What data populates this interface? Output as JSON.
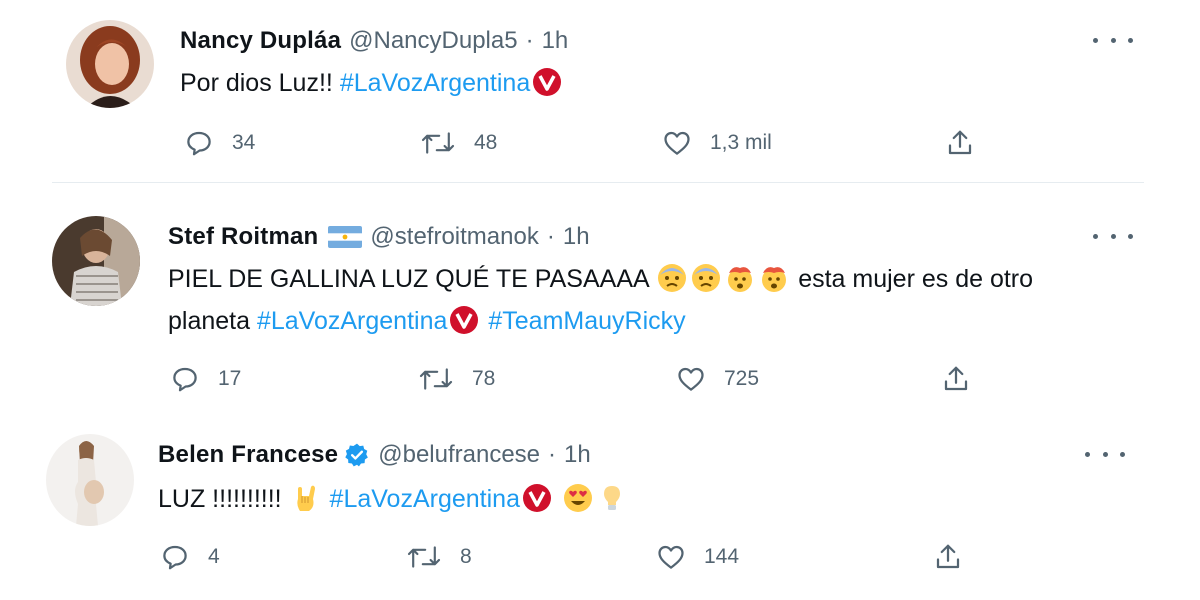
{
  "tweets": [
    {
      "name": "Nancy Dupláa",
      "handle": "@NancyDupla5",
      "separator": "·",
      "time": "1h",
      "text_before": "Por dios Luz!! ",
      "hashtags": [
        "#LaVozArgentina"
      ],
      "replies": "34",
      "retweets": "48",
      "likes": "1,3 mil"
    },
    {
      "name": "Stef Roitman",
      "handle": "@stefroitmanok",
      "separator": "·",
      "time": "1h",
      "text_line1": "PIEL DE GALLINA LUZ QUÉ TE PASAAAA",
      "text_line1_after": " esta mujer es de otro",
      "text_line2": "planeta ",
      "hashtags": [
        "#LaVozArgentina",
        "#TeamMauyRicky"
      ],
      "replies": "17",
      "retweets": "78",
      "likes": "725"
    },
    {
      "name": "Belen Francese",
      "handle": "@belufrancese",
      "separator": "·",
      "time": "1h",
      "text_before": "LUZ !!!!!!!!!! ",
      "hashtags": [
        "#LaVozArgentina"
      ],
      "replies": "4",
      "retweets": "8",
      "likes": "144"
    }
  ],
  "icons": {
    "reply": "reply-icon",
    "retweet": "retweet-icon",
    "like": "like-icon",
    "share": "share-icon",
    "more": "more-icon",
    "verified": "verified-badge-icon",
    "flag": "argentina-flag-icon"
  },
  "colors": {
    "hashtag": "#1d9bf0",
    "secondary": "#536471",
    "verified": "#1d9bf0",
    "brand_badge": "#d0102b"
  }
}
